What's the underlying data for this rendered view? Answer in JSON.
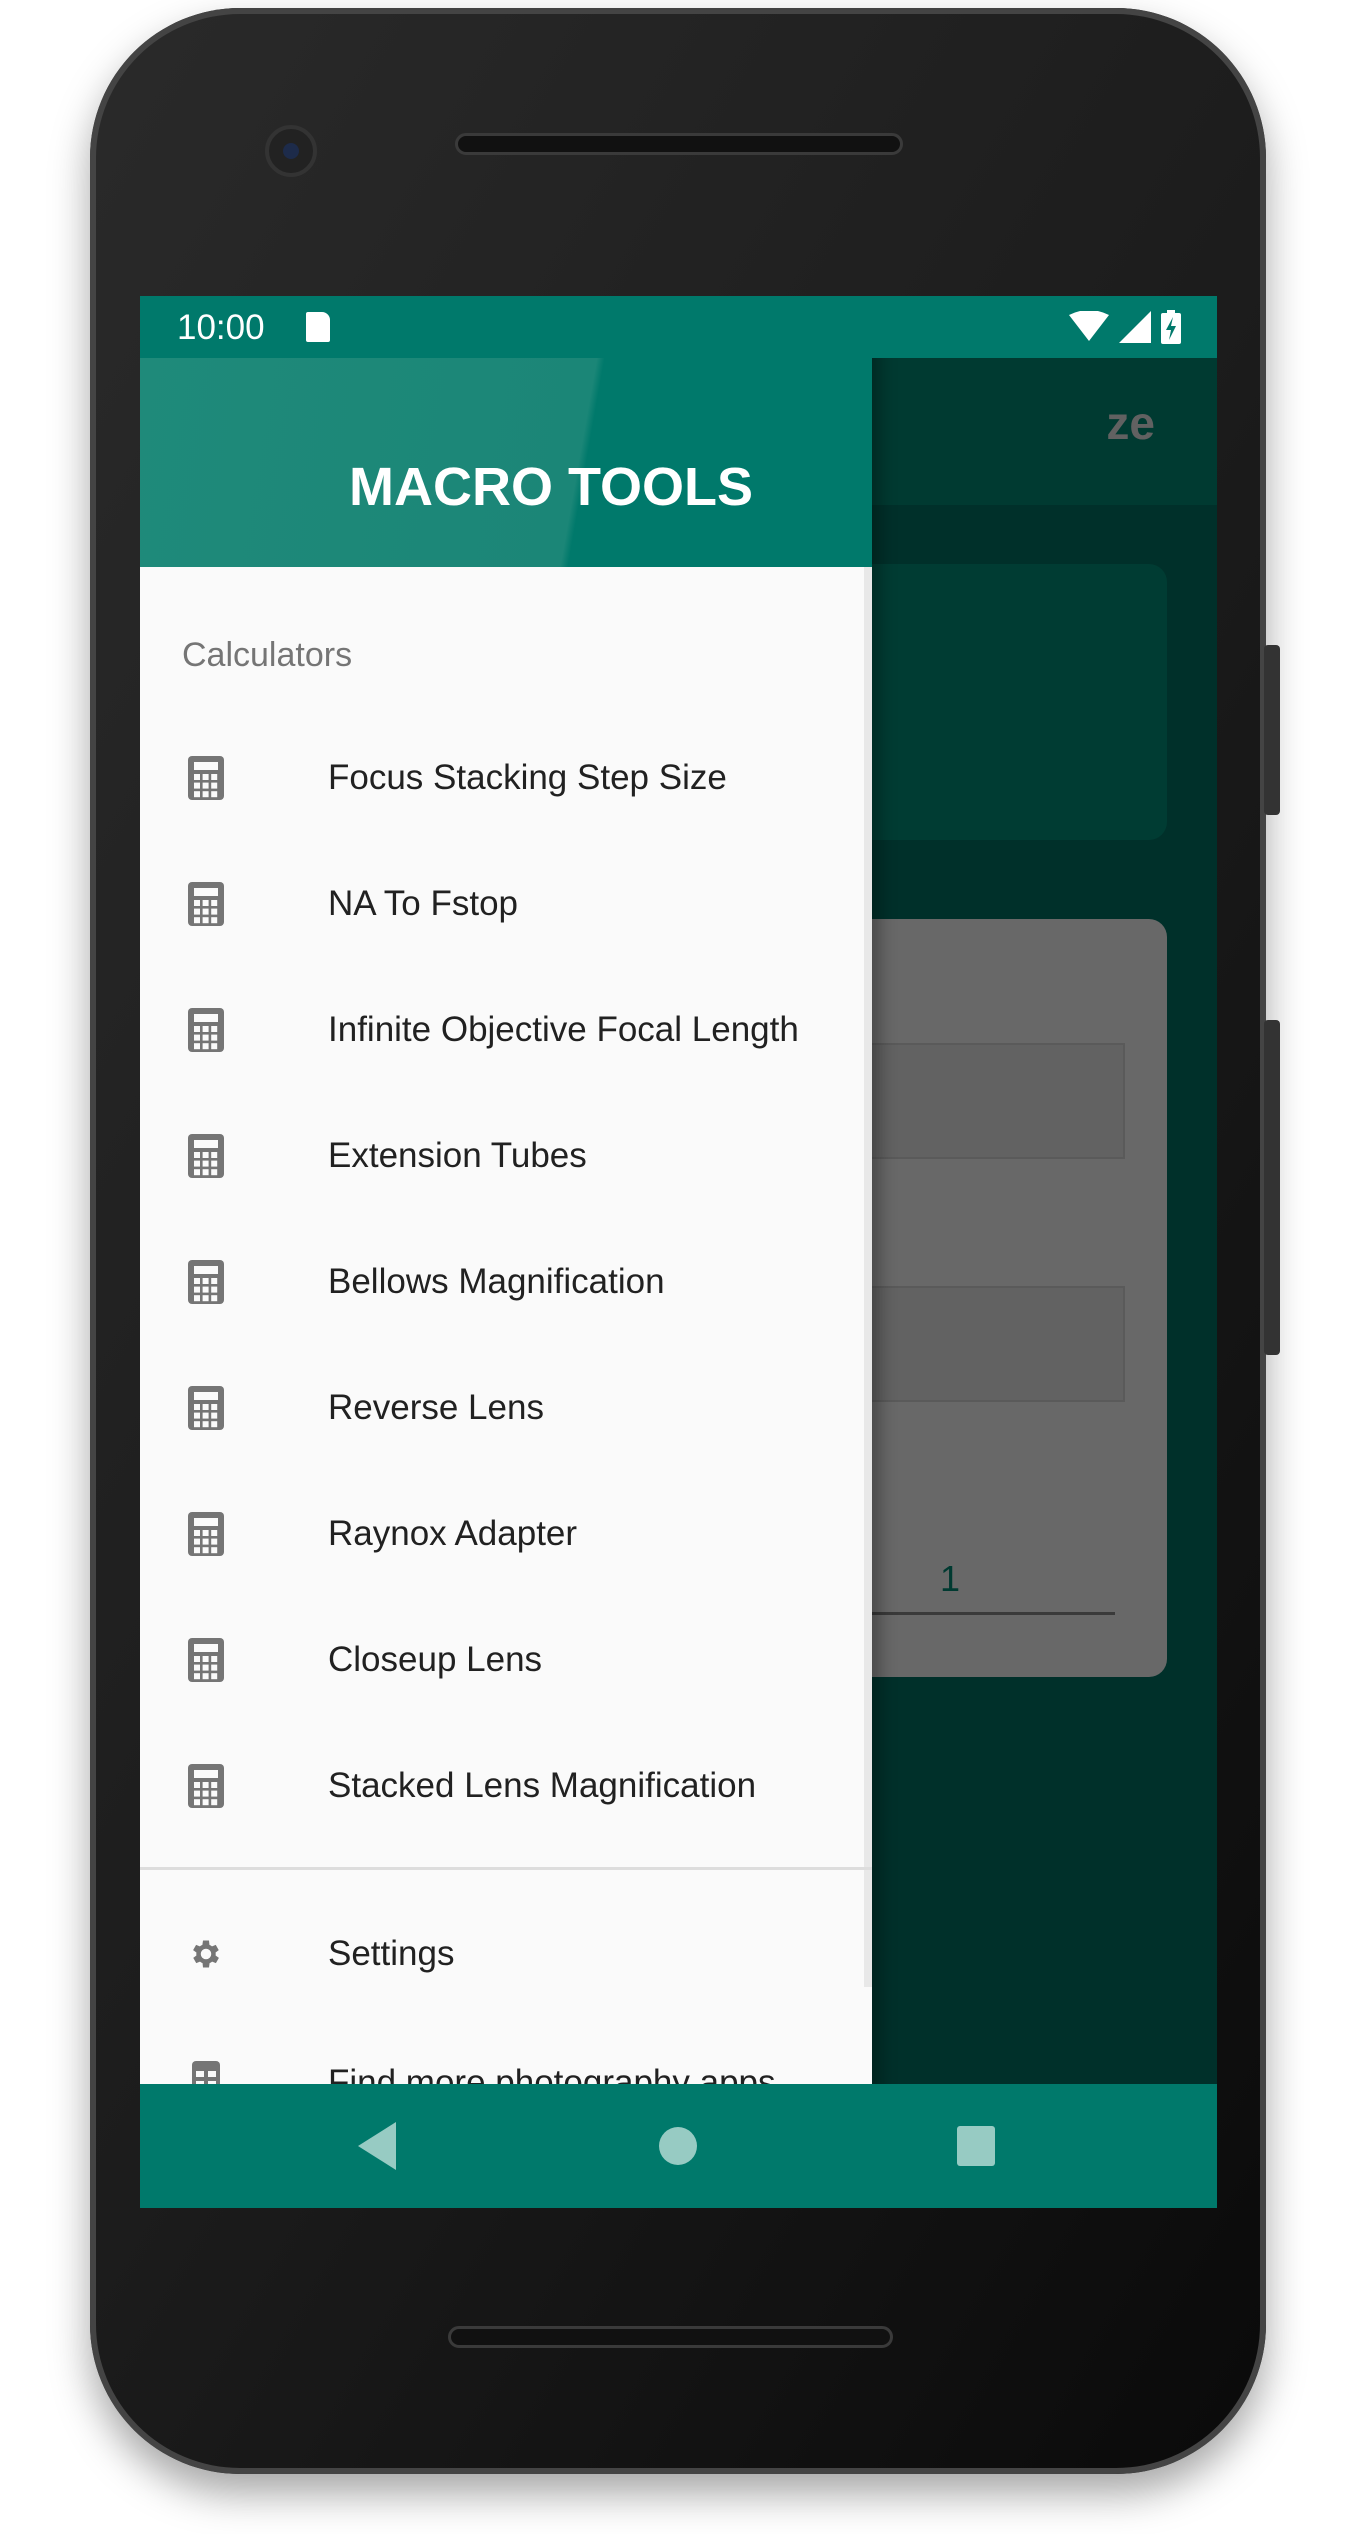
{
  "status_bar": {
    "time": "10:00",
    "icons": [
      "sd-card-icon",
      "wifi-icon",
      "signal-icon",
      "battery-charging-icon"
    ]
  },
  "main": {
    "title_fragment": "ze",
    "field_value": "1"
  },
  "drawer": {
    "title": "MACRO TOOLS",
    "section": "Calculators",
    "items": [
      {
        "label": "Focus Stacking Step Size",
        "icon": "calculator-icon"
      },
      {
        "label": "NA To Fstop",
        "icon": "calculator-icon"
      },
      {
        "label": "Infinite Objective Focal Length",
        "icon": "calculator-icon"
      },
      {
        "label": "Extension Tubes",
        "icon": "calculator-icon"
      },
      {
        "label": "Bellows Magnification",
        "icon": "calculator-icon"
      },
      {
        "label": "Reverse Lens",
        "icon": "calculator-icon"
      },
      {
        "label": "Raynox Adapter",
        "icon": "calculator-icon"
      },
      {
        "label": "Closeup Lens",
        "icon": "calculator-icon"
      },
      {
        "label": "Stacked Lens Magnification",
        "icon": "calculator-icon"
      }
    ],
    "settings": {
      "label": "Settings",
      "icon": "gear-icon"
    },
    "more": {
      "label": "Find more photography apps",
      "icon": "apps-icon"
    }
  },
  "colors": {
    "primary": "#00796b",
    "drawer_bg": "#fafafa"
  }
}
